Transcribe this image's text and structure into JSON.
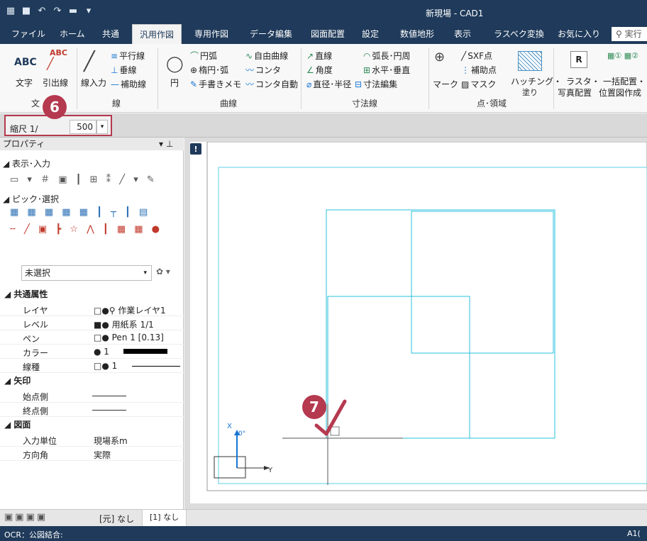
{
  "window": {
    "title": "新現場 - CAD1"
  },
  "menu": {
    "tabs": [
      "ファイル",
      "ホーム",
      "共通",
      "汎用作図",
      "専用作図",
      "データ編集",
      "図面配置",
      "設定",
      "数値地形",
      "表示",
      "ラスベク変換",
      "お気に入り"
    ],
    "search_placeholder": "実行"
  },
  "ribbon": {
    "text_group": {
      "abc1": "ABC",
      "abc2": "ABC",
      "moji": "文字",
      "hikidashi": "引出線",
      "label": "文"
    },
    "line_group": {
      "heiko": "平行線",
      "suisen": "垂線",
      "senyuryoku": "線入力",
      "hojosen": "補助線",
      "label": "線"
    },
    "curve_group": {
      "enko": "円弧",
      "jiyu": "自由曲線",
      "daen": "楕円･弧",
      "konta": "コンタ",
      "en": "円",
      "tegaki": "手書きメモ",
      "konta_auto": "コンタ自動",
      "label": "曲線"
    },
    "dim_group": {
      "chokusen": "直線",
      "kocho": "弧長･円周",
      "kakudo": "角度",
      "suihei": "水平･垂直",
      "chokkei": "直径･半径",
      "sunpo": "寸法編集",
      "label": "寸法線"
    },
    "point_group": {
      "sxf": "SXF点",
      "hojoten": "補助点",
      "mark": "マーク",
      "mask": "マスク",
      "hatch": "ハッチング・",
      "nuri": "塗り",
      "label": "点･領域"
    },
    "raster_group": {
      "raster": "ラスタ・",
      "shashin": "写真配置",
      "ikkatsu": "一括配置・",
      "ichizu": "位置図作成"
    }
  },
  "scale": {
    "label": "縮尺 1/",
    "value": "500"
  },
  "badges": {
    "six": "6",
    "seven": "7"
  },
  "panel": {
    "title": "プロパティ",
    "sec_display": "表示･入力",
    "sec_pick": "ピック･選択",
    "select_value": "未選択",
    "common": "共通属性",
    "rows": [
      {
        "k": "レイヤ",
        "v": "□●⚲ 作業レイヤ1"
      },
      {
        "k": "レベル",
        "v": "■● 用紙系 1/1"
      },
      {
        "k": "ペン",
        "v": "□● Pen 1 [0.13]"
      },
      {
        "k": "カラー",
        "v": "● 1"
      },
      {
        "k": "線種",
        "v": "□● 1"
      }
    ],
    "arrow": "矢印",
    "arrow_rows": [
      {
        "k": "始点側"
      },
      {
        "k": "終点側"
      }
    ],
    "drawing": "図面",
    "drawing_rows": [
      {
        "k": "入力単位",
        "v": "現場系m"
      },
      {
        "k": "方向角",
        "v": "実際"
      }
    ]
  },
  "bottom": {
    "tab1": "[元] なし",
    "tab2": "[1] なし"
  },
  "status": {
    "left": "OCR：公図結合:",
    "right": "A1("
  },
  "canvas": {
    "axis_x": "X",
    "axis_y": "Y",
    "deg": "0°"
  }
}
